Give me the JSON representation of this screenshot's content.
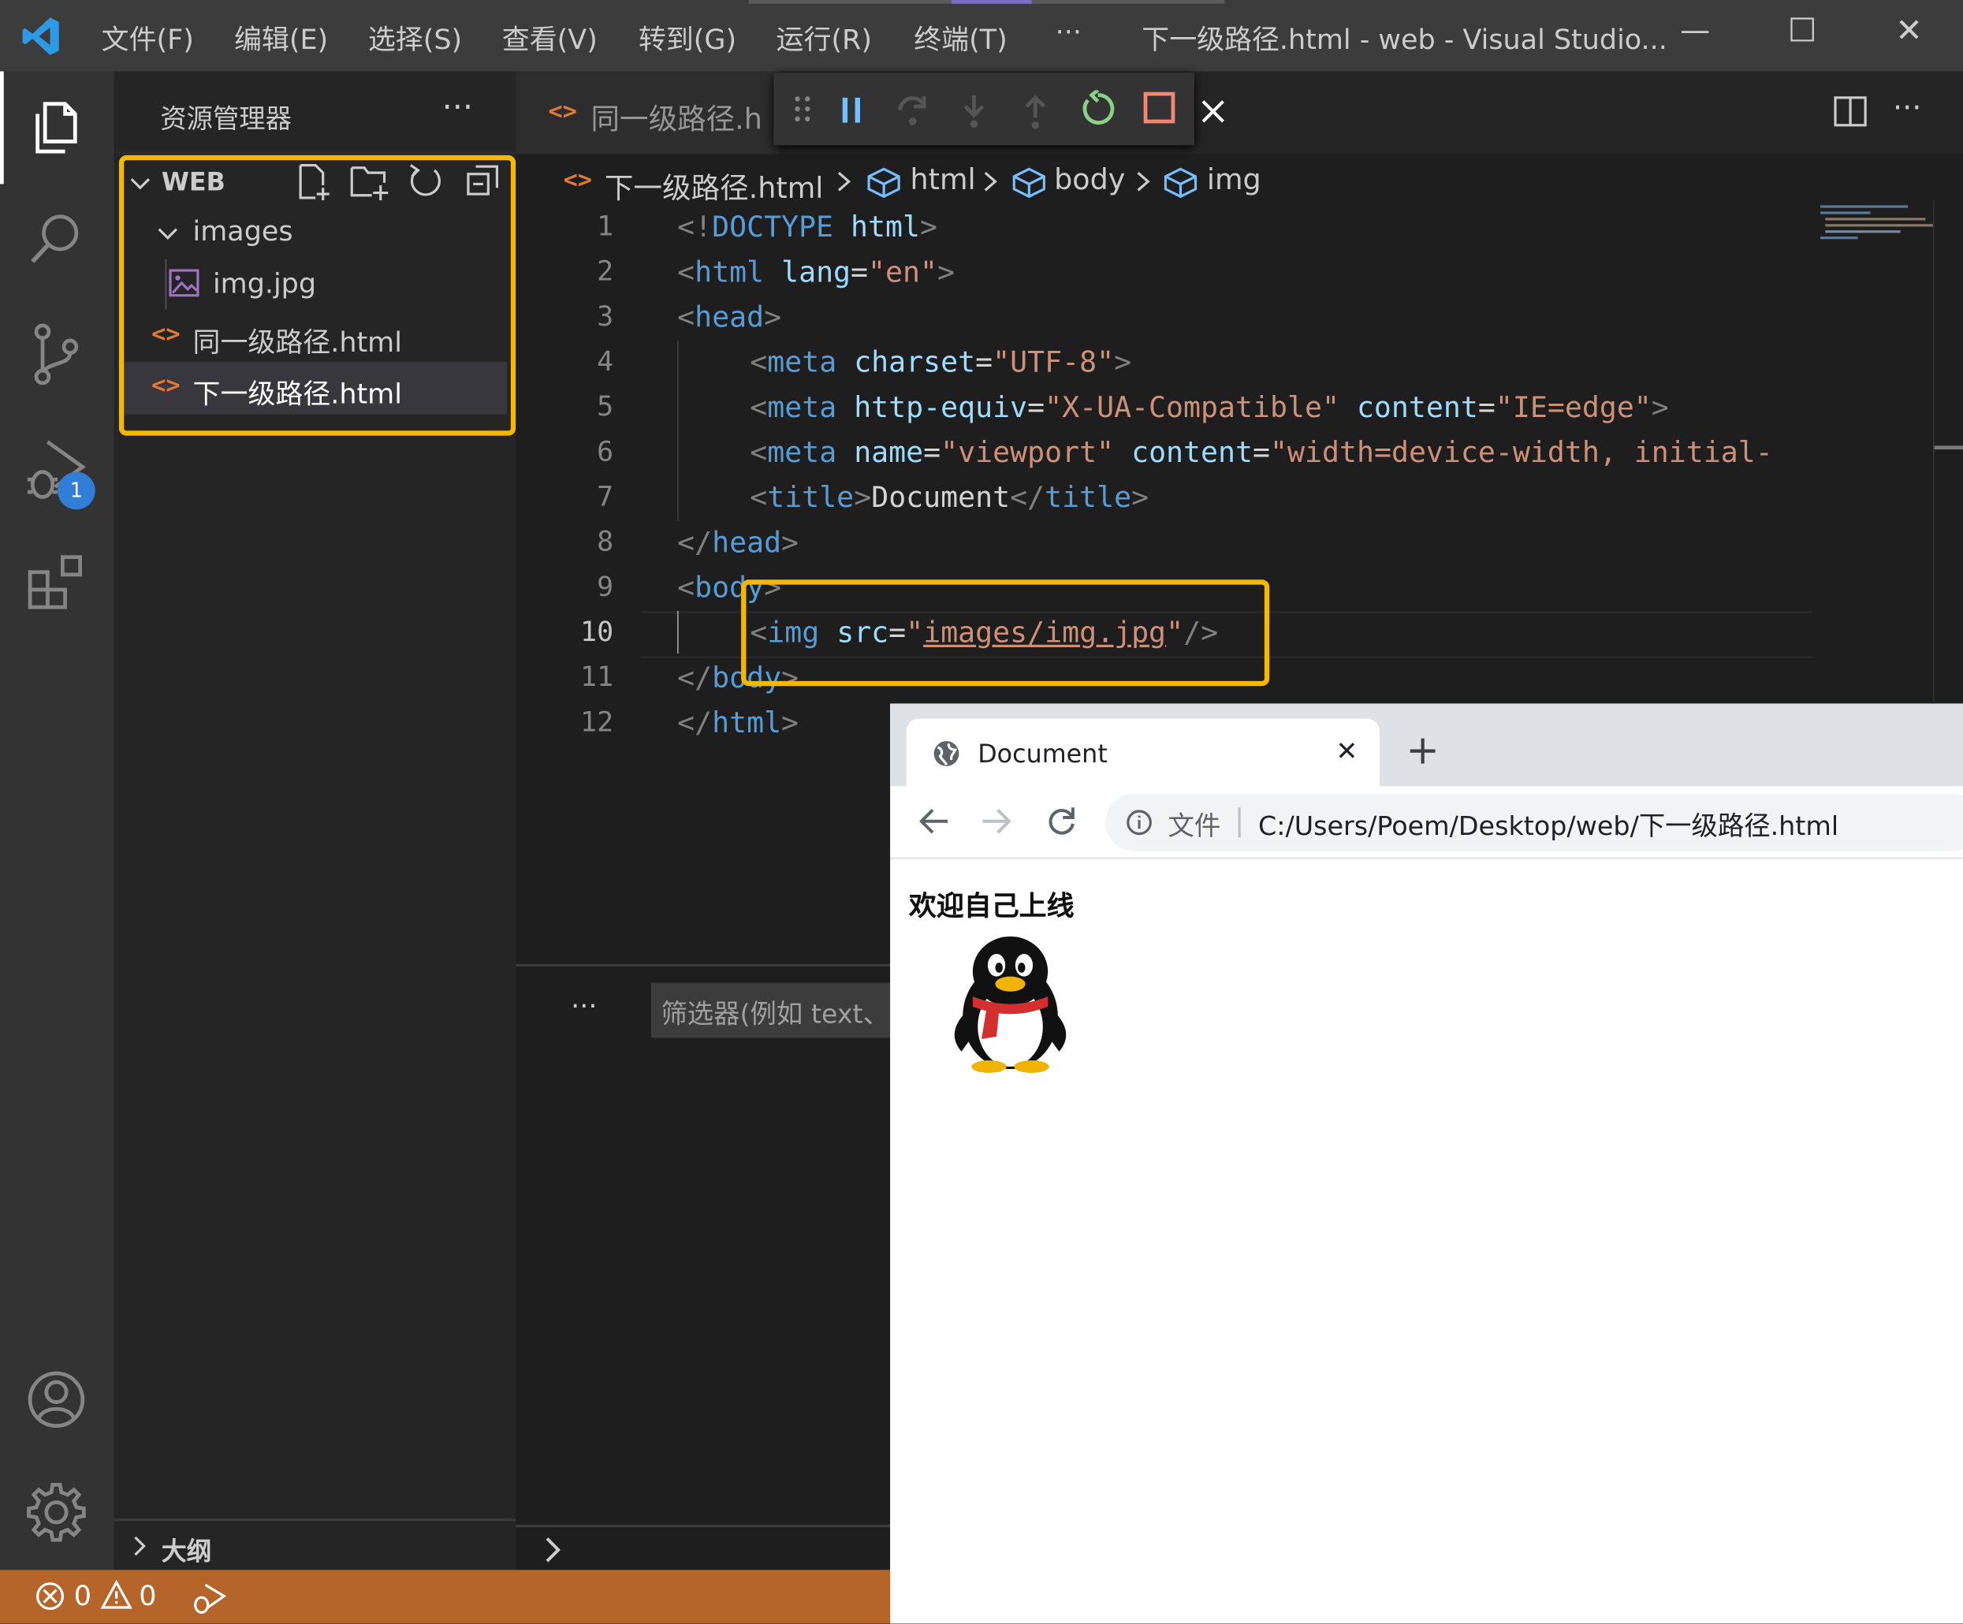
{
  "app": {
    "menus": [
      "文件(F)",
      "编辑(E)",
      "选择(S)",
      "查看(V)",
      "转到(G)",
      "运行(R)",
      "终端(T)",
      "···"
    ],
    "window_title": "下一级路径.html - web - Visual Studio...",
    "window_controls": {
      "minimize": "—",
      "maximize": "☐",
      "close": "✕"
    }
  },
  "activity_bar": {
    "run_badge": "1",
    "items": [
      "explorer-icon",
      "search-icon",
      "source-control-icon",
      "run-debug-icon",
      "extensions-icon",
      "account-icon",
      "settings-gear-icon"
    ]
  },
  "explorer": {
    "title": "资源管理器",
    "more": "···",
    "root": "WEB",
    "folder": "images",
    "files": {
      "image": "img.jpg",
      "same_level": "同一级路径.html",
      "next_level": "下一级路径.html"
    },
    "outline": "大纲"
  },
  "editor": {
    "tab_label": "同一级路径.h",
    "breadcrumb": {
      "file": "下一级路径.html",
      "html": "html",
      "body": "body",
      "img": "img"
    },
    "line_numbers": [
      "1",
      "2",
      "3",
      "4",
      "5",
      "6",
      "7",
      "8",
      "9",
      "10",
      "11",
      "12"
    ],
    "code": {
      "l1": {
        "open": "<!",
        "kw": "DOCTYPE",
        "sp": " ",
        "name": "html",
        "close": ">"
      },
      "l2": {
        "lt": "<",
        "tag": "html",
        "sp": " ",
        "attr": "lang",
        "eq": "=",
        "val": "\"en\"",
        "gt": ">"
      },
      "l3": {
        "lt": "<",
        "tag": "head",
        "gt": ">"
      },
      "l4": {
        "lt": "<",
        "tag": "meta",
        "sp": " ",
        "attr": "charset",
        "eq": "=",
        "val": "\"UTF-8\"",
        "gt": ">"
      },
      "l5": {
        "lt": "<",
        "tag": "meta",
        "sp": " ",
        "attr1": "http-equiv",
        "eq1": "=",
        "val1": "\"X-UA-Compatible\"",
        "sp2": " ",
        "attr2": "content",
        "eq2": "=",
        "val2": "\"IE=edge\"",
        "gt": ">"
      },
      "l6": {
        "lt": "<",
        "tag": "meta",
        "sp": " ",
        "attr1": "name",
        "eq1": "=",
        "val1": "\"viewport\"",
        "sp2": " ",
        "attr2": "content",
        "eq2": "=",
        "val2": "\"width=device-width, initial-"
      },
      "l7": {
        "lt": "<",
        "tag": "title",
        "gt": ">",
        "text": "Document",
        "lt2": "</",
        "tag2": "title",
        "gt2": ">"
      },
      "l8": {
        "lt": "</",
        "tag": "head",
        "gt": ">"
      },
      "l9": {
        "lt": "<",
        "tag": "body",
        "gt": ">"
      },
      "l10": {
        "lt": "<",
        "tag": "img",
        "sp": " ",
        "attr": "src",
        "eq": "=",
        "q1": "\"",
        "path": "images/img.jpg",
        "q2": "\"",
        "close": "/>"
      },
      "l11": {
        "lt": "</",
        "tag": "body",
        "gt": ">"
      },
      "l12": {
        "lt": "</",
        "tag": "html",
        "gt": ">"
      }
    }
  },
  "panel": {
    "more": "···",
    "filter_placeholder": "筛选器(例如 text、"
  },
  "status_bar": {
    "errors": "0",
    "warnings": "0"
  },
  "browser": {
    "tab_title": "Document",
    "tab_close": "✕",
    "new_tab": "+",
    "url_scheme_label": "文件",
    "url": "C:/Users/Poem/Desktop/web/下一级路径.html",
    "page_image_caption": "欢迎自己上线"
  },
  "colors": {
    "highlight": "#f5b800",
    "status_bar": "#b5652a",
    "tag": "#569cd6",
    "attribute": "#9cdcfe",
    "string": "#ce9178"
  }
}
